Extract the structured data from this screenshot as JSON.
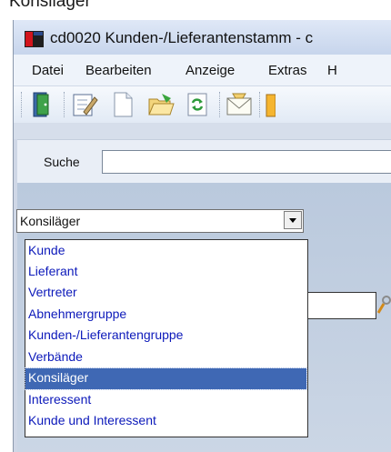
{
  "caption": "Konsiläger",
  "window": {
    "title": "cd0020 Kunden-/Lieferantenstamm - c",
    "menu": [
      "Datei",
      "Bearbeiten",
      "Anzeige",
      "Extras",
      "H"
    ]
  },
  "toolbar": {
    "buttons": [
      {
        "name": "exit-icon"
      },
      {
        "name": "edit-form-icon"
      },
      {
        "name": "new-document-icon"
      },
      {
        "name": "open-folder-icon"
      },
      {
        "name": "refresh-icon"
      },
      {
        "name": "mail-icon"
      },
      {
        "name": "partial-icon"
      }
    ]
  },
  "search": {
    "label": "Suche",
    "value": ""
  },
  "combo": {
    "selected": "Konsiläger"
  },
  "dropdown": {
    "items": [
      "Kunde",
      "Lieferant",
      "Vertreter",
      "Abnehmergruppe",
      "Kunden-/Lieferantengruppe",
      "Verbände",
      "Konsiläger",
      "Interessent",
      "Kunde und Interessent"
    ],
    "selected_index": 6
  },
  "colors": {
    "item_text": "#0c19ba",
    "selection": "#3f68b4"
  }
}
